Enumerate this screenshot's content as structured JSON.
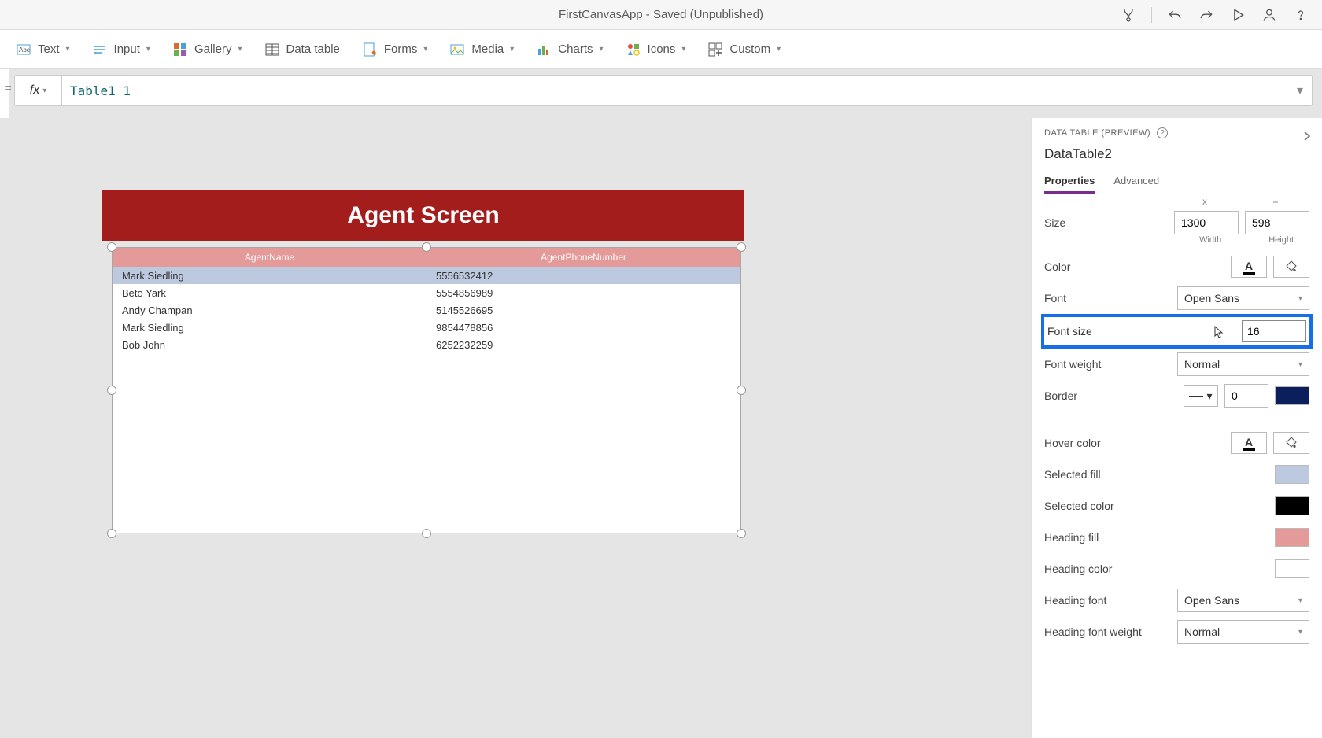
{
  "titlebar": {
    "title": "FirstCanvasApp - Saved (Unpublished)",
    "icons": [
      "health-icon",
      "undo-icon",
      "redo-icon",
      "play-icon",
      "person-icon",
      "help-icon"
    ]
  },
  "ribbon": {
    "text": "Text",
    "input": "Input",
    "gallery": "Gallery",
    "datatable": "Data table",
    "forms": "Forms",
    "media": "Media",
    "charts": "Charts",
    "icons": "Icons",
    "custom": "Custom"
  },
  "formula": {
    "prefix": "=",
    "fx": "fx",
    "value": "Table1_1"
  },
  "screen": {
    "header": "Agent Screen"
  },
  "table": {
    "columns": [
      "AgentName",
      "AgentPhoneNumber"
    ],
    "rows": [
      {
        "name": "Mark Siedling",
        "phone": "5556532412",
        "selected": true
      },
      {
        "name": "Beto Yark",
        "phone": "5554856989",
        "selected": false
      },
      {
        "name": "Andy Champan",
        "phone": "5145526695",
        "selected": false
      },
      {
        "name": "Mark Siedling",
        "phone": "9854478856",
        "selected": false
      },
      {
        "name": "Bob John",
        "phone": "6252232259",
        "selected": false
      }
    ]
  },
  "props": {
    "type_label": "DATA TABLE (PREVIEW)",
    "control_name": "DataTable2",
    "tabs": {
      "properties": "Properties",
      "advanced": "Advanced"
    },
    "size": {
      "label": "Size",
      "width": "1300",
      "height": "598",
      "width_label": "Width",
      "height_label": "Height"
    },
    "color": {
      "label": "Color"
    },
    "font": {
      "label": "Font",
      "value": "Open Sans"
    },
    "font_size": {
      "label": "Font size",
      "value": "16"
    },
    "font_weight": {
      "label": "Font weight",
      "value": "Normal"
    },
    "border": {
      "label": "Border",
      "value": "0"
    },
    "hover_color": {
      "label": "Hover color"
    },
    "selected_fill": {
      "label": "Selected fill",
      "color": "#bcc9de"
    },
    "selected_color": {
      "label": "Selected color",
      "color": "#000000"
    },
    "heading_fill": {
      "label": "Heading fill",
      "color": "#e59a9a"
    },
    "heading_color": {
      "label": "Heading color",
      "color": "#ffffff"
    },
    "heading_font": {
      "label": "Heading font",
      "value": "Open Sans"
    },
    "heading_font_weight": {
      "label": "Heading font weight",
      "value": "Normal"
    },
    "border_color": "#0b1f5c"
  }
}
